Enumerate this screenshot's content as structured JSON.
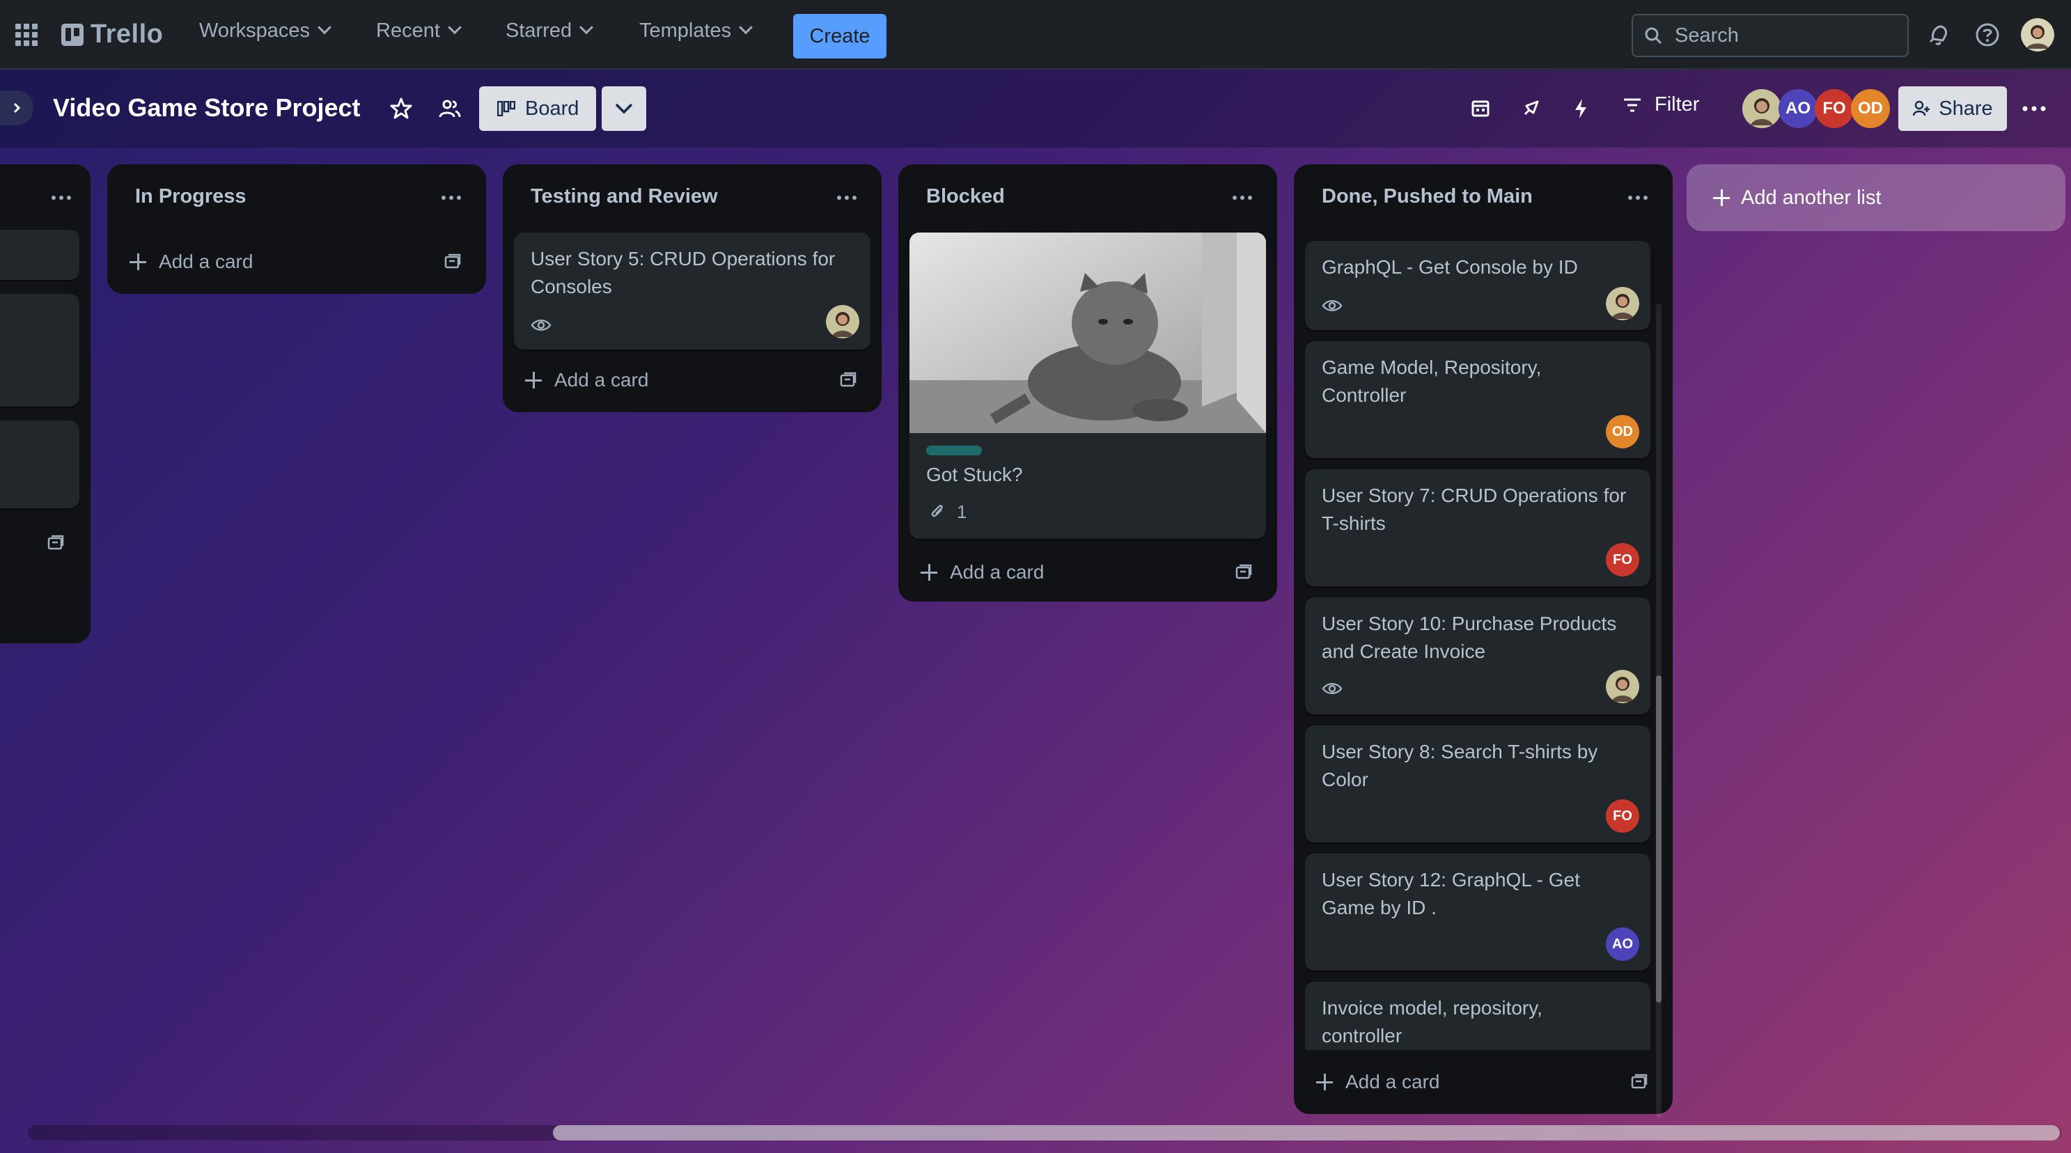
{
  "topbar": {
    "logo_text": "Trello",
    "nav": [
      {
        "label": "Workspaces"
      },
      {
        "label": "Recent"
      },
      {
        "label": "Starred"
      },
      {
        "label": "Templates"
      }
    ],
    "create_label": "Create",
    "search_placeholder": "Search"
  },
  "board": {
    "title": "Video Game Store Project",
    "view_label": "Board",
    "filter_label": "Filter",
    "share_label": "Share",
    "members": [
      {
        "initials": "",
        "color": "#c9c39c"
      },
      {
        "initials": "AO",
        "color": "#4c44b8"
      },
      {
        "initials": "FO",
        "color": "#c9372c"
      },
      {
        "initials": "OD",
        "color": "#e2852b"
      }
    ],
    "add_list_label": "Add another list"
  },
  "lists": [
    {
      "title": "",
      "cards": []
    },
    {
      "title": "In Progress",
      "add_card": "Add a card"
    },
    {
      "title": "Testing and Review",
      "add_card": "Add a card",
      "cards": [
        {
          "title": "User Story 5: CRUD Operations for Consoles"
        }
      ]
    },
    {
      "title": "Blocked",
      "add_card": "Add a card",
      "cards": [
        {
          "title": "Got Stuck?",
          "attachments": "1",
          "label_color": "#1f6a6a"
        }
      ]
    },
    {
      "title": "Done, Pushed to Main",
      "add_card": "Add a card",
      "cards": [
        {
          "title": "GraphQL - Get Console by ID"
        },
        {
          "title": "Game Model, Repository, Controller",
          "member": "OD"
        },
        {
          "title": "User Story 7: CRUD Operations for T-shirts",
          "member": "FO"
        },
        {
          "title": "User Story 10: Purchase Products and Create Invoice"
        },
        {
          "title": "User Story 8: Search T-shirts by Color",
          "member": "FO"
        },
        {
          "title": "User Story 12: GraphQL - Get Game by ID .",
          "member": "AO"
        },
        {
          "title": "Invoice model, repository, controller"
        }
      ]
    }
  ]
}
